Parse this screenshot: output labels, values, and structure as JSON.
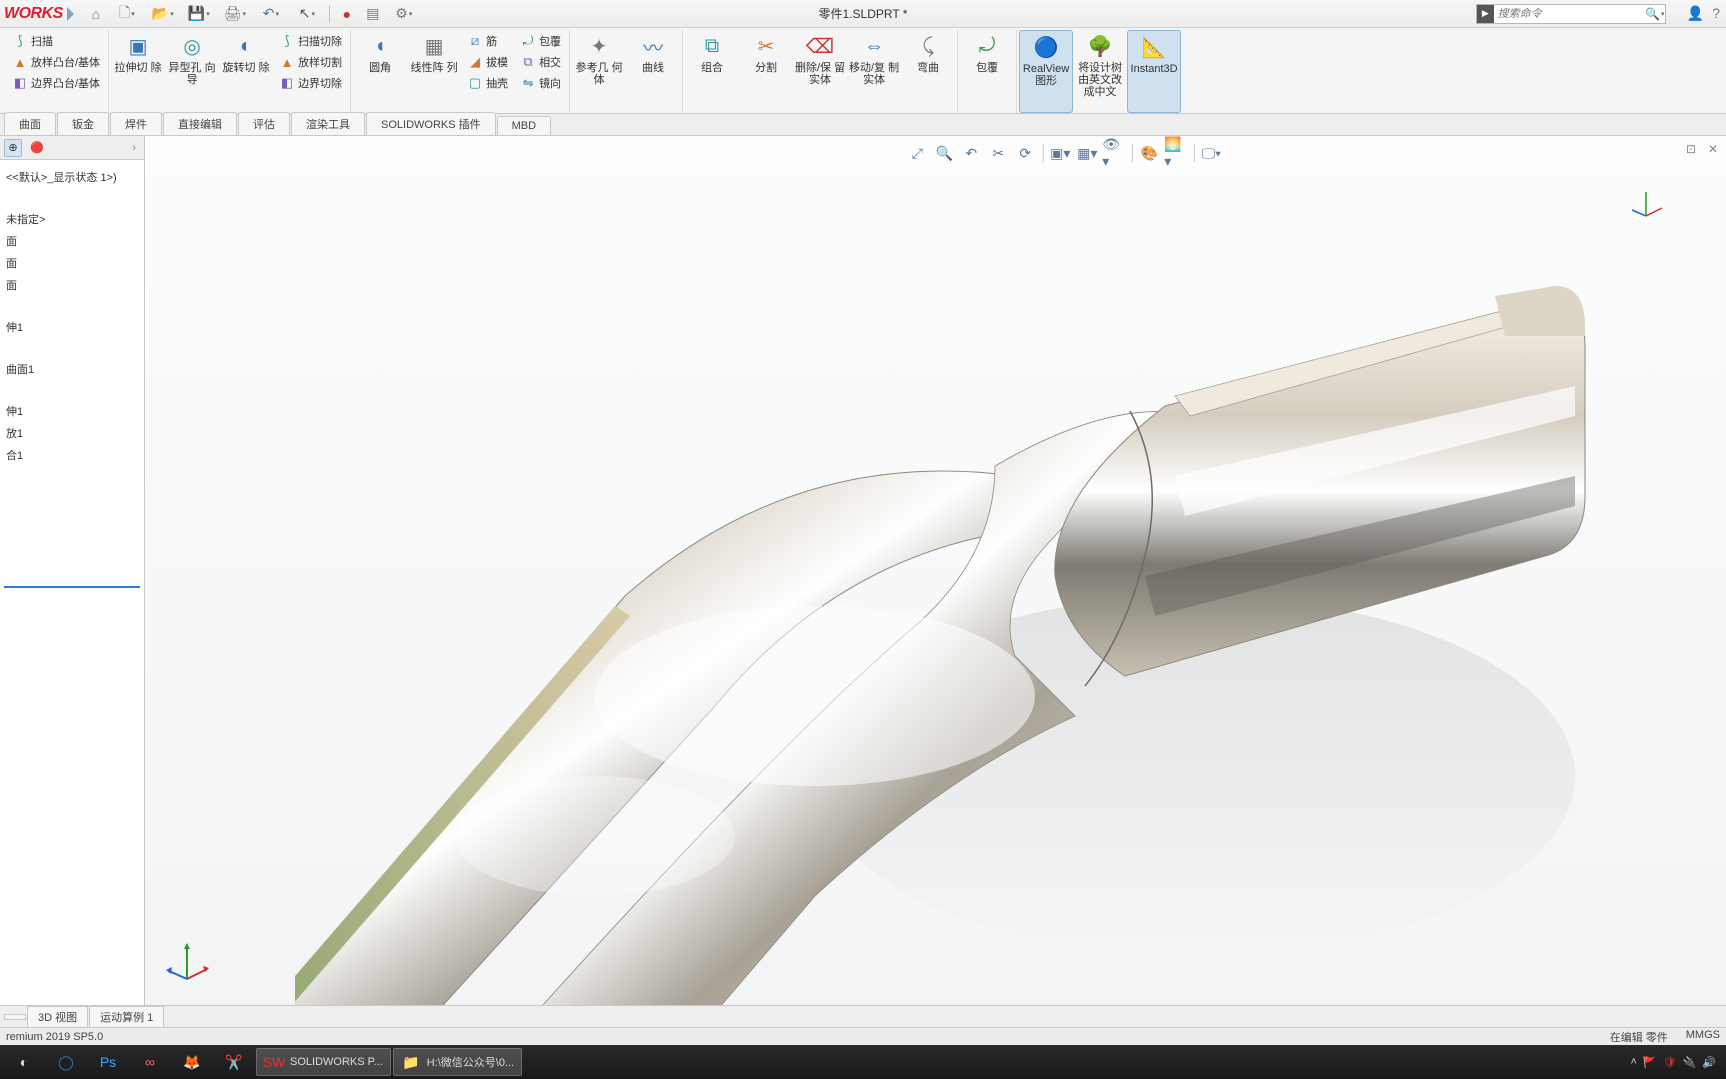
{
  "app": {
    "logo": "WORKS",
    "title": "零件1.SLDPRT *",
    "search_placeholder": "搜索命令"
  },
  "qat": {
    "home": "⌂",
    "new": "🗋",
    "open": "📂",
    "save": "💾",
    "print": "🖨",
    "undo": "↶",
    "select": "↖",
    "rebuild": "●",
    "options": "▤",
    "settings": "⚙"
  },
  "ribbon": {
    "stack_boss": {
      "sweep": "扫描",
      "loft": "放样凸台/基体",
      "boundary": "边界凸台/基体"
    },
    "stack_cut_big": {
      "extrude_cut": "拉伸切\n除",
      "hole": "异型孔\n向导",
      "revolve_cut": "旋转切\n除"
    },
    "stack_cut": {
      "sweep_cut": "扫描切除",
      "loft_cut": "放样切割",
      "boundary_cut": "边界切除"
    },
    "stack_feat_big": {
      "fillet": "圆角",
      "pattern": "线性阵\n列"
    },
    "stack_feat": {
      "rib": "筋",
      "draft": "拔模",
      "shell": "抽壳"
    },
    "stack_feat2": {
      "wrap": "包覆",
      "intersect": "相交",
      "mirror": "镜向"
    },
    "big": {
      "refgeo": "参考几\n何体",
      "curves": "曲线",
      "combine": "组合",
      "split": "分割",
      "delete_keep": "删除/保\n留实体",
      "move_copy": "移动/复\n制实体",
      "bend": "弯曲",
      "wrap2": "包覆",
      "realview": "RealView\n图形",
      "designtree": "将设计树\n由英文改\n成中文",
      "instant3d": "Instant3D"
    }
  },
  "cmdtabs": [
    "曲面",
    "钣金",
    "焊件",
    "直接编辑",
    "评估",
    "渲染工具",
    "SOLIDWORKS 插件",
    "MBD"
  ],
  "side": {
    "state": "<<默认>_显示状态 1>)",
    "unspec": "未指定>",
    "p1": "面",
    "p2": "面",
    "p3": "面",
    "f1": "伸1",
    "f2": "曲面1",
    "f3": "伸1",
    "f4": "放1",
    "f5": "合1"
  },
  "viewtabs": [
    "",
    "3D 视图",
    "运动算例 1"
  ],
  "status": {
    "left": "remium 2019 SP5.0",
    "edit": "在编辑 零件",
    "units": "MMGS"
  },
  "taskbar": {
    "sw": "SOLIDWORKS P...",
    "folder": "H:\\微信公众号\\0..."
  }
}
